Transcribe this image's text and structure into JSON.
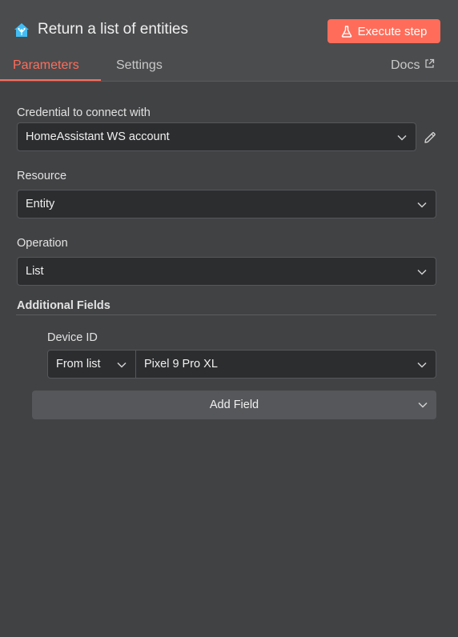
{
  "header": {
    "title": "Return a list of entities",
    "execute_label": "Execute step",
    "node_icon": "home-assistant-icon",
    "accent_color": "#ff6d5a"
  },
  "tabs": [
    {
      "label": "Parameters",
      "active": true
    },
    {
      "label": "Settings",
      "active": false
    }
  ],
  "docs_label": "Docs",
  "fields": {
    "credential": {
      "label": "Credential to connect with",
      "value": "HomeAssistant WS account"
    },
    "resource": {
      "label": "Resource",
      "value": "Entity"
    },
    "operation": {
      "label": "Operation",
      "value": "List"
    },
    "additional_fields_label": "Additional Fields",
    "device_id": {
      "label": "Device ID",
      "mode": "From list",
      "value": "Pixel 9 Pro XL"
    },
    "add_field_label": "Add Field"
  }
}
